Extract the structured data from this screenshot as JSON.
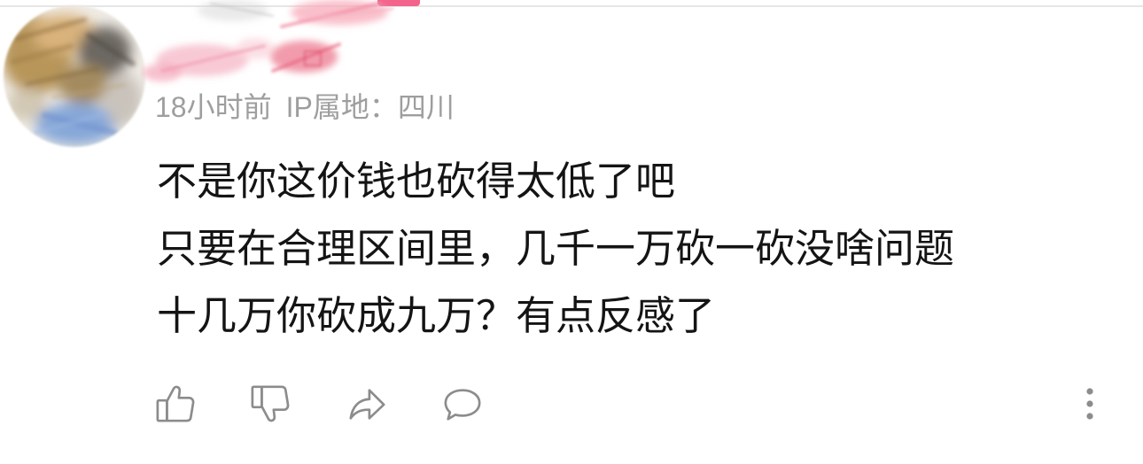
{
  "colors": {
    "accent": "#f2648c",
    "divider": "#e6e6e6",
    "text": "#141414",
    "meta": "#9e9e9e",
    "icon": "#8c8c8c"
  },
  "comment": {
    "avatar_icon": "avatar",
    "meta": {
      "time": "18小时前",
      "ip_location": "IP属地：四川"
    },
    "lines": [
      "不是你这价钱也砍得太低了吧",
      "只要在合理区间里，几千一万砍一砍没啥问题",
      "十几万你砍成九万？有点反感了"
    ]
  },
  "actions": {
    "like": {
      "icon": "thumbs-up-icon"
    },
    "dislike": {
      "icon": "thumbs-down-icon"
    },
    "share": {
      "icon": "share-icon"
    },
    "reply": {
      "icon": "comment-icon"
    },
    "more": {
      "icon": "more-vertical-icon"
    }
  }
}
